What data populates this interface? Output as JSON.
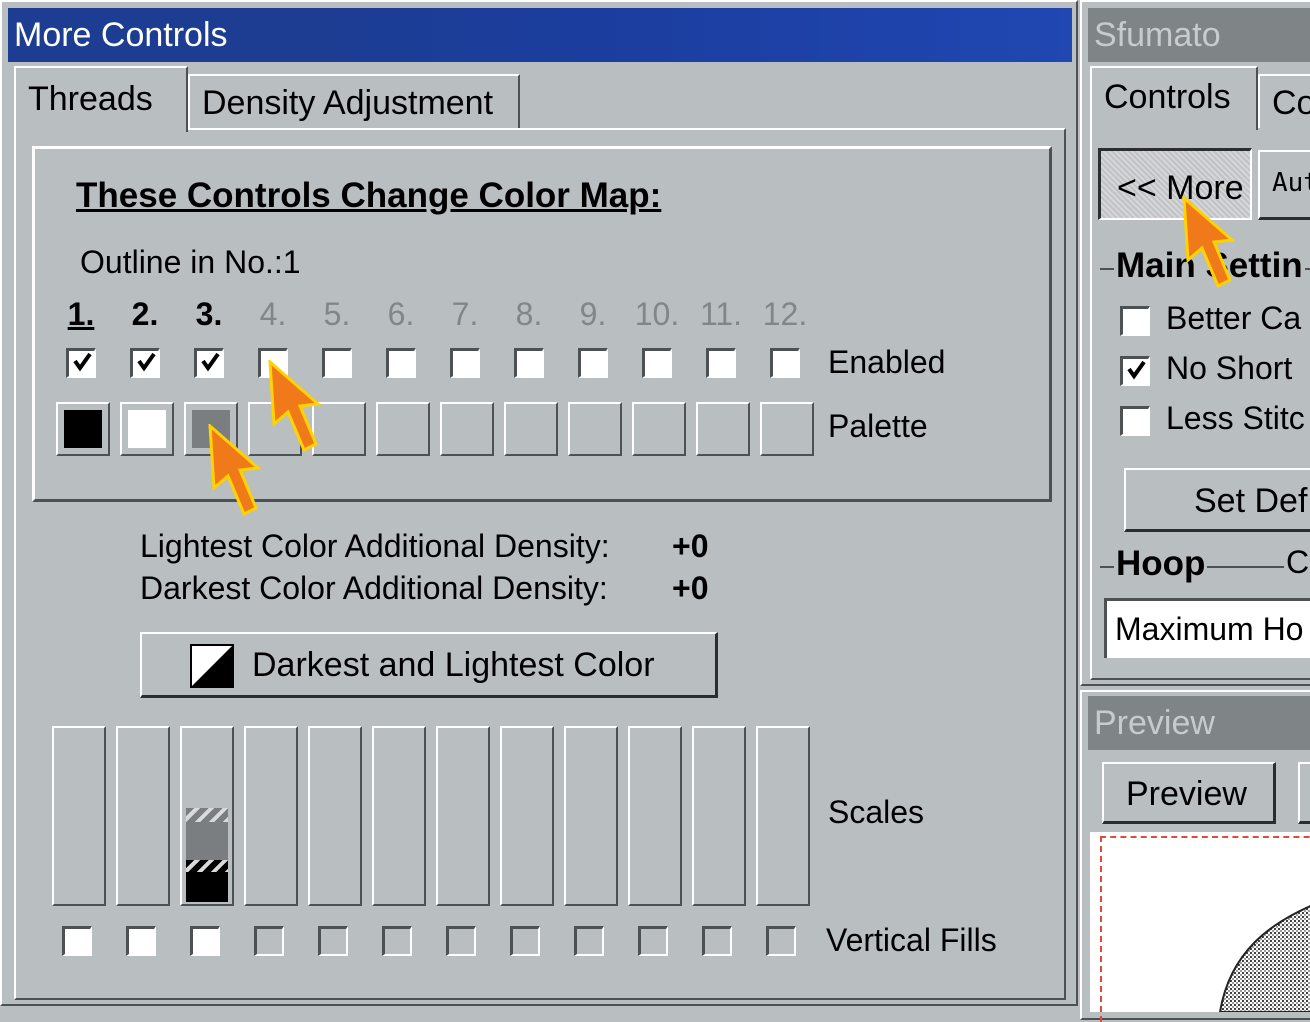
{
  "more_controls": {
    "title": "More Controls",
    "tabs": [
      {
        "label": "Threads"
      },
      {
        "label": "Density Adjustment"
      }
    ],
    "color_map": {
      "heading": "These Controls Change Color Map:",
      "outline_label": "Outline in No.:1",
      "numbers": [
        "1.",
        "2.",
        "3.",
        "4.",
        "5.",
        "6.",
        "7.",
        "8.",
        "9.",
        "10.",
        "11.",
        "12."
      ],
      "enabled_label": "Enabled",
      "palette_label": "Palette",
      "palette_colors": [
        "#000000",
        "#ffffff",
        "#7a7e80",
        "",
        "",
        "",
        "",
        "",
        "",
        "",
        "",
        ""
      ]
    },
    "lightest_label": "Lightest Color Additional Density:",
    "lightest_value": "+0",
    "darkest_label": "Darkest Color Additional Density:",
    "darkest_value": "+0",
    "dark_light_button": "Darkest and Lightest Color",
    "scales_label": "Scales",
    "vertical_fills_label": "Vertical Fills"
  },
  "sfumato": {
    "title": "Sfumato Stitch",
    "tabs": [
      {
        "label": "Controls"
      },
      {
        "label": "Co"
      }
    ],
    "more_button": "<< More",
    "auto_button": "Aut",
    "main_settings_label": "Main Settin",
    "checkboxes": [
      {
        "label": "Better Ca",
        "checked": false
      },
      {
        "label": "No Short",
        "checked": true
      },
      {
        "label": "Less Stitc",
        "checked": false
      }
    ],
    "set_default_button": "Set Def",
    "hoop_label": "Hoop",
    "hoop_suffix": "C",
    "hoop_select": "Maximum Ho"
  },
  "preview_window": {
    "title": "Preview",
    "preview_button": "Preview"
  },
  "colors": {
    "face": "#b9bec1",
    "title_active": "#1d3d93",
    "arrow_orange": "#f07a1a"
  }
}
